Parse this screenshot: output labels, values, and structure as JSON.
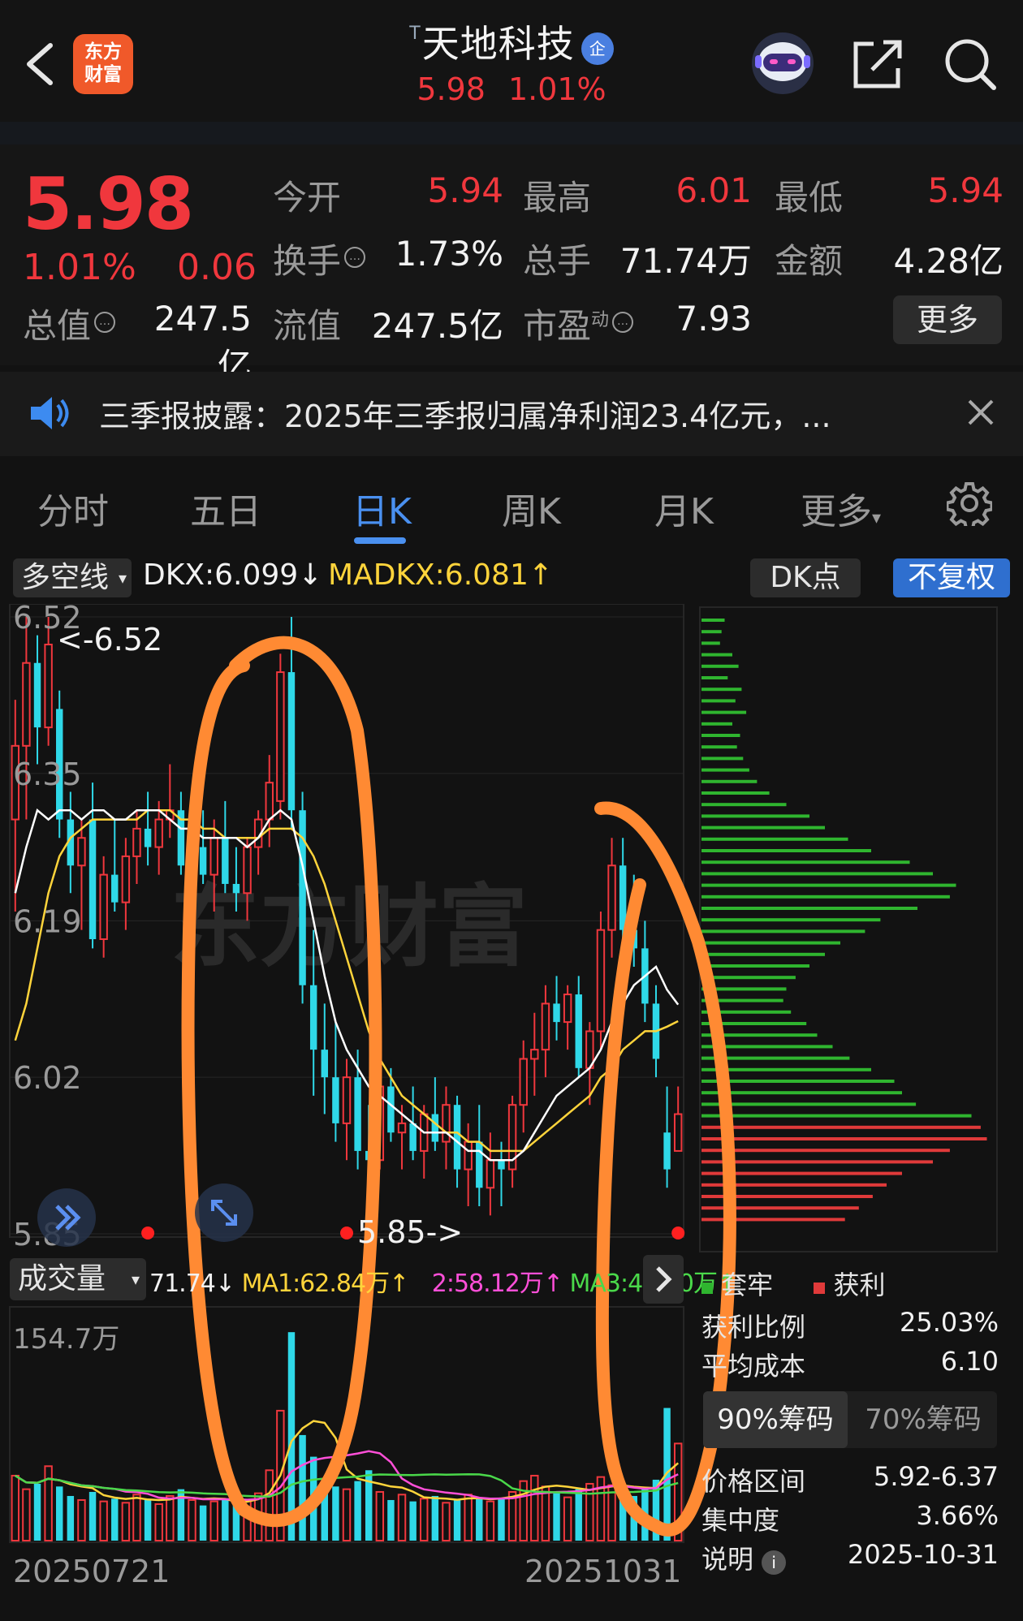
{
  "header": {
    "app_logo_text": "东方财富",
    "stock_name": "天地科技",
    "tag_mark": "T",
    "badge": "企",
    "price": "5.98",
    "change_pct": "1.01%"
  },
  "quote": {
    "price": "5.98",
    "change_pct": "1.01%",
    "change_amt": "0.06",
    "open_label": "今开",
    "open": "5.94",
    "high_label": "最高",
    "high": "6.01",
    "low_label": "最低",
    "low": "5.94",
    "turnover_label": "换手",
    "turnover": "1.73%",
    "volume_label": "总手",
    "volume": "71.74万",
    "amount_label": "金额",
    "amount": "4.28亿",
    "mktcap_label": "总值",
    "mktcap": "247.5亿",
    "float_label": "流值",
    "float_cap": "247.5亿",
    "pe_label": "市盈",
    "pe_sup": "动",
    "pe": "7.93",
    "more_label": "更多"
  },
  "notice": {
    "text": "三季报披露：2025年三季报归属净利润23.4亿元，..."
  },
  "tabs": [
    "分时",
    "五日",
    "日K",
    "周K",
    "月K",
    "更多"
  ],
  "active_tab": "日K",
  "indicator": {
    "select_label": "多空线",
    "dkx": "DKX:6.099↓",
    "madkx": "MADKX:6.081↑",
    "dk_point_label": "DK点",
    "fq_label": "不复权"
  },
  "price_axis": {
    "ticks": [
      "6.52",
      "6.35",
      "6.19",
      "6.02",
      "5.85"
    ],
    "high_marker": "<-6.52",
    "low_marker": "5.85->"
  },
  "volume": {
    "select_label": "成交量",
    "vol": "71.74",
    "ma1": "MA1:62.84万↑",
    "ma2": "2:58.12万↑",
    "ma3": "MA3:47.90万↑",
    "axis_max": "154.7万"
  },
  "dates": {
    "start": "20250721",
    "end": "20251031"
  },
  "watermark": "东方财富",
  "chips": {
    "legend_trapped": "套牢",
    "legend_profit": "获利",
    "profit_ratio_label": "获利比例",
    "profit_ratio": "25.03%",
    "avg_cost_label": "平均成本",
    "avg_cost": "6.10",
    "tab90": "90%筹码",
    "tab70": "70%筹码",
    "range_label": "价格区间",
    "range": "5.92-6.37",
    "concentration_label": "集中度",
    "concentration": "3.66%",
    "note_label": "说明",
    "note_date": "2025-10-31"
  },
  "colors": {
    "up": "#f0373d",
    "down": "#2fd8e8",
    "dkx_line": "#ffffff",
    "madkx_line": "#ffd43b",
    "annotation": "#ff8a33",
    "accent": "#4a90f0"
  },
  "chart_data": {
    "type": "candlestick",
    "y_range": [
      5.85,
      6.52
    ],
    "x_range": [
      "20250721",
      "20251031"
    ],
    "candles": [
      {
        "o": 6.3,
        "h": 6.43,
        "l": 6.2,
        "c": 6.38
      },
      {
        "o": 6.38,
        "h": 6.52,
        "l": 6.3,
        "c": 6.47
      },
      {
        "o": 6.47,
        "h": 6.5,
        "l": 6.36,
        "c": 6.4
      },
      {
        "o": 6.4,
        "h": 6.52,
        "l": 6.38,
        "c": 6.49
      },
      {
        "o": 6.42,
        "h": 6.44,
        "l": 6.28,
        "c": 6.3
      },
      {
        "o": 6.3,
        "h": 6.33,
        "l": 6.22,
        "c": 6.25
      },
      {
        "o": 6.25,
        "h": 6.3,
        "l": 6.18,
        "c": 6.28
      },
      {
        "o": 6.3,
        "h": 6.34,
        "l": 6.16,
        "c": 6.17
      },
      {
        "o": 6.17,
        "h": 6.26,
        "l": 6.15,
        "c": 6.24
      },
      {
        "o": 6.24,
        "h": 6.3,
        "l": 6.2,
        "c": 6.21
      },
      {
        "o": 6.21,
        "h": 6.28,
        "l": 6.18,
        "c": 6.26
      },
      {
        "o": 6.26,
        "h": 6.31,
        "l": 6.23,
        "c": 6.29
      },
      {
        "o": 6.29,
        "h": 6.33,
        "l": 6.25,
        "c": 6.27
      },
      {
        "o": 6.27,
        "h": 6.32,
        "l": 6.24,
        "c": 6.3
      },
      {
        "o": 6.3,
        "h": 6.36,
        "l": 6.28,
        "c": 6.31
      },
      {
        "o": 6.31,
        "h": 6.33,
        "l": 6.24,
        "c": 6.25
      },
      {
        "o": 6.25,
        "h": 6.3,
        "l": 6.22,
        "c": 6.27
      },
      {
        "o": 6.27,
        "h": 6.31,
        "l": 6.23,
        "c": 6.24
      },
      {
        "o": 6.24,
        "h": 6.3,
        "l": 6.2,
        "c": 6.28
      },
      {
        "o": 6.28,
        "h": 6.32,
        "l": 6.22,
        "c": 6.23
      },
      {
        "o": 6.23,
        "h": 6.27,
        "l": 6.2,
        "c": 6.22
      },
      {
        "o": 6.22,
        "h": 6.28,
        "l": 6.19,
        "c": 6.27
      },
      {
        "o": 6.27,
        "h": 6.31,
        "l": 6.24,
        "c": 6.3
      },
      {
        "o": 6.3,
        "h": 6.37,
        "l": 6.27,
        "c": 6.34
      },
      {
        "o": 6.32,
        "h": 6.48,
        "l": 6.3,
        "c": 6.46
      },
      {
        "o": 6.46,
        "h": 6.52,
        "l": 6.29,
        "c": 6.31
      },
      {
        "o": 6.31,
        "h": 6.33,
        "l": 6.1,
        "c": 6.12
      },
      {
        "o": 6.12,
        "h": 6.18,
        "l": 6.0,
        "c": 6.05
      },
      {
        "o": 6.05,
        "h": 6.1,
        "l": 5.98,
        "c": 6.02
      },
      {
        "o": 6.02,
        "h": 6.08,
        "l": 5.95,
        "c": 5.97
      },
      {
        "o": 5.97,
        "h": 6.04,
        "l": 5.93,
        "c": 6.02
      },
      {
        "o": 6.02,
        "h": 6.05,
        "l": 5.92,
        "c": 5.94
      },
      {
        "o": 5.94,
        "h": 5.99,
        "l": 5.88,
        "c": 5.93
      },
      {
        "o": 5.93,
        "h": 6.02,
        "l": 5.92,
        "c": 6.01
      },
      {
        "o": 6.01,
        "h": 6.03,
        "l": 5.95,
        "c": 5.96
      },
      {
        "o": 5.96,
        "h": 5.99,
        "l": 5.92,
        "c": 5.97
      },
      {
        "o": 5.97,
        "h": 6.01,
        "l": 5.93,
        "c": 5.94
      },
      {
        "o": 5.94,
        "h": 5.99,
        "l": 5.91,
        "c": 5.98
      },
      {
        "o": 5.98,
        "h": 6.02,
        "l": 5.94,
        "c": 5.95
      },
      {
        "o": 5.95,
        "h": 6.01,
        "l": 5.92,
        "c": 5.99
      },
      {
        "o": 5.99,
        "h": 6.0,
        "l": 5.9,
        "c": 5.92
      },
      {
        "o": 5.92,
        "h": 5.97,
        "l": 5.88,
        "c": 5.95
      },
      {
        "o": 5.95,
        "h": 5.99,
        "l": 5.88,
        "c": 5.9
      },
      {
        "o": 5.9,
        "h": 5.96,
        "l": 5.87,
        "c": 5.93
      },
      {
        "o": 5.93,
        "h": 5.95,
        "l": 5.88,
        "c": 5.92
      },
      {
        "o": 5.92,
        "h": 6.0,
        "l": 5.9,
        "c": 5.99
      },
      {
        "o": 5.99,
        "h": 6.06,
        "l": 5.96,
        "c": 6.04
      },
      {
        "o": 6.04,
        "h": 6.09,
        "l": 6.0,
        "c": 6.05
      },
      {
        "o": 6.05,
        "h": 6.12,
        "l": 6.02,
        "c": 6.1
      },
      {
        "o": 6.1,
        "h": 6.13,
        "l": 6.06,
        "c": 6.08
      },
      {
        "o": 6.08,
        "h": 6.12,
        "l": 6.05,
        "c": 6.11
      },
      {
        "o": 6.11,
        "h": 6.13,
        "l": 6.02,
        "c": 6.03
      },
      {
        "o": 6.03,
        "h": 6.08,
        "l": 5.99,
        "c": 6.07
      },
      {
        "o": 6.07,
        "h": 6.2,
        "l": 6.05,
        "c": 6.18
      },
      {
        "o": 6.18,
        "h": 6.28,
        "l": 6.15,
        "c": 6.25
      },
      {
        "o": 6.25,
        "h": 6.28,
        "l": 6.16,
        "c": 6.18
      },
      {
        "o": 6.18,
        "h": 6.24,
        "l": 6.14,
        "c": 6.16
      },
      {
        "o": 6.16,
        "h": 6.19,
        "l": 6.08,
        "c": 6.1
      },
      {
        "o": 6.1,
        "h": 6.12,
        "l": 6.02,
        "c": 6.04
      },
      {
        "o": 5.96,
        "h": 6.01,
        "l": 5.9,
        "c": 5.92
      },
      {
        "o": 5.94,
        "h": 6.01,
        "l": 5.94,
        "c": 5.98
      }
    ],
    "volume_max_label": "154.7万",
    "volumes": [
      48,
      38,
      42,
      55,
      40,
      33,
      30,
      36,
      29,
      31,
      28,
      34,
      30,
      27,
      33,
      38,
      30,
      26,
      29,
      31,
      28,
      30,
      35,
      52,
      96,
      154,
      78,
      62,
      45,
      40,
      38,
      44,
      52,
      36,
      30,
      34,
      29,
      31,
      33,
      28,
      30,
      34,
      32,
      29,
      31,
      36,
      44,
      48,
      40,
      35,
      32,
      38,
      42,
      47,
      41,
      36,
      33,
      39,
      45,
      98,
      71.74
    ],
    "dkx": [
      6.22,
      6.27,
      6.31,
      6.3,
      6.31,
      6.31,
      6.3,
      6.31,
      6.31,
      6.3,
      6.3,
      6.31,
      6.31,
      6.31,
      6.3,
      6.29,
      6.29,
      6.28,
      6.28,
      6.28,
      6.28,
      6.27,
      6.28,
      6.3,
      6.31,
      6.3,
      6.25,
      6.19,
      6.13,
      6.08,
      6.05,
      6.03,
      6.01,
      6.0,
      5.99,
      5.98,
      5.97,
      5.96,
      5.96,
      5.96,
      5.95,
      5.94,
      5.94,
      5.93,
      5.93,
      5.93,
      5.94,
      5.96,
      5.98,
      6.0,
      6.01,
      6.02,
      6.03,
      6.05,
      6.08,
      6.1,
      6.12,
      6.13,
      6.14,
      6.115,
      6.099
    ],
    "madkx": [
      6.06,
      6.1,
      6.16,
      6.22,
      6.26,
      6.28,
      6.29,
      6.3,
      6.3,
      6.3,
      6.3,
      6.3,
      6.31,
      6.31,
      6.31,
      6.3,
      6.3,
      6.29,
      6.29,
      6.28,
      6.28,
      6.28,
      6.28,
      6.29,
      6.29,
      6.29,
      6.28,
      6.26,
      6.23,
      6.19,
      6.15,
      6.11,
      6.07,
      6.04,
      6.02,
      6.0,
      5.99,
      5.98,
      5.97,
      5.96,
      5.96,
      5.95,
      5.95,
      5.94,
      5.94,
      5.94,
      5.94,
      5.95,
      5.96,
      5.97,
      5.98,
      5.99,
      6.0,
      6.02,
      6.03,
      6.05,
      6.06,
      6.07,
      6.07,
      6.075,
      6.081
    ]
  }
}
